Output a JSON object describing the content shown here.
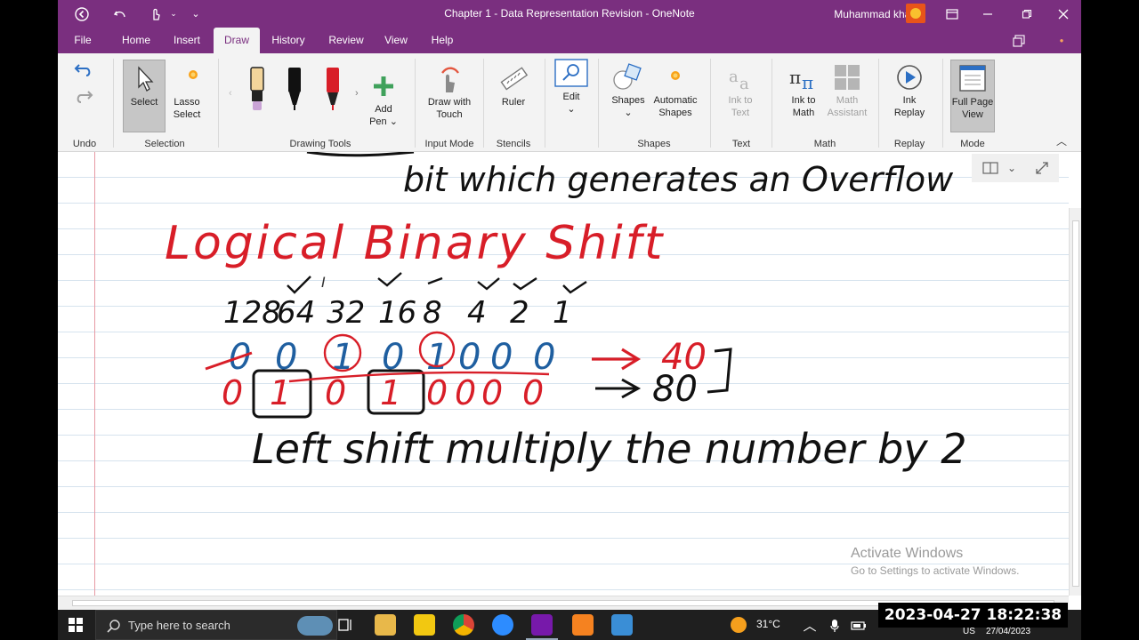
{
  "window": {
    "title": "Chapter 1 - Data Representation Revision  -  OneNote",
    "user": "Muhammad khan"
  },
  "tabs": [
    {
      "label": "File"
    },
    {
      "label": "Home"
    },
    {
      "label": "Insert"
    },
    {
      "label": "Draw"
    },
    {
      "label": "History"
    },
    {
      "label": "Review"
    },
    {
      "label": "View"
    },
    {
      "label": "Help"
    }
  ],
  "active_tab": "Draw",
  "ribbon": {
    "groups": {
      "undo": "Undo",
      "selection": "Selection",
      "drawing_tools": "Drawing Tools",
      "input_mode": "Input Mode",
      "stencils": "Stencils",
      "shapes": "Shapes",
      "text": "Text",
      "math": "Math",
      "replay": "Replay",
      "mode": "Mode"
    },
    "buttons": {
      "select": "Select",
      "lasso_1": "Lasso",
      "lasso_2": "Select",
      "add_pen_1": "Add",
      "add_pen_2": "Pen",
      "draw_touch_1": "Draw with",
      "draw_touch_2": "Touch",
      "ruler": "Ruler",
      "edit": "Edit",
      "shapes": "Shapes",
      "auto_shapes_1": "Automatic",
      "auto_shapes_2": "Shapes",
      "ink_text_1": "Ink to",
      "ink_text_2": "Text",
      "ink_math_1": "Ink to",
      "ink_math_2": "Math",
      "math_assist_1": "Math",
      "math_assist_2": "Assistant",
      "ink_replay_1": "Ink",
      "ink_replay_2": "Replay",
      "full_page_1": "Full Page",
      "full_page_2": "View"
    },
    "colors": {
      "accent": "#7a2f7f",
      "pen_yellow": "#f3d59b",
      "pen_black": "#111111",
      "pen_red": "#d81e28"
    }
  },
  "note": {
    "partial_line": "bit which generates an Overflow",
    "heading": "Logical Binary Shift",
    "place_values": [
      "128",
      "64",
      "32",
      "16",
      "8",
      "4",
      "2",
      "1"
    ],
    "row1_bits": [
      "0",
      "0",
      "1",
      "0",
      "1",
      "0",
      "0",
      "0"
    ],
    "row1_result": "40",
    "row2_bits": [
      "0",
      "1",
      "0",
      "1",
      "0",
      "0",
      "0",
      "0"
    ],
    "row2_result": "80",
    "summary": "Left shift multiply the number by 2",
    "colors": {
      "red": "#d81e28",
      "blue": "#1f5fa0",
      "black": "#111111"
    }
  },
  "watermark": {
    "line1": "Activate Windows",
    "line2": "Go to Settings to activate Windows."
  },
  "taskbar": {
    "search_placeholder": "Type here to search",
    "temperature": "31°C",
    "language": "US",
    "date_small": "27/04/2023",
    "timestamp": "2023-04-27  18:22:38"
  }
}
